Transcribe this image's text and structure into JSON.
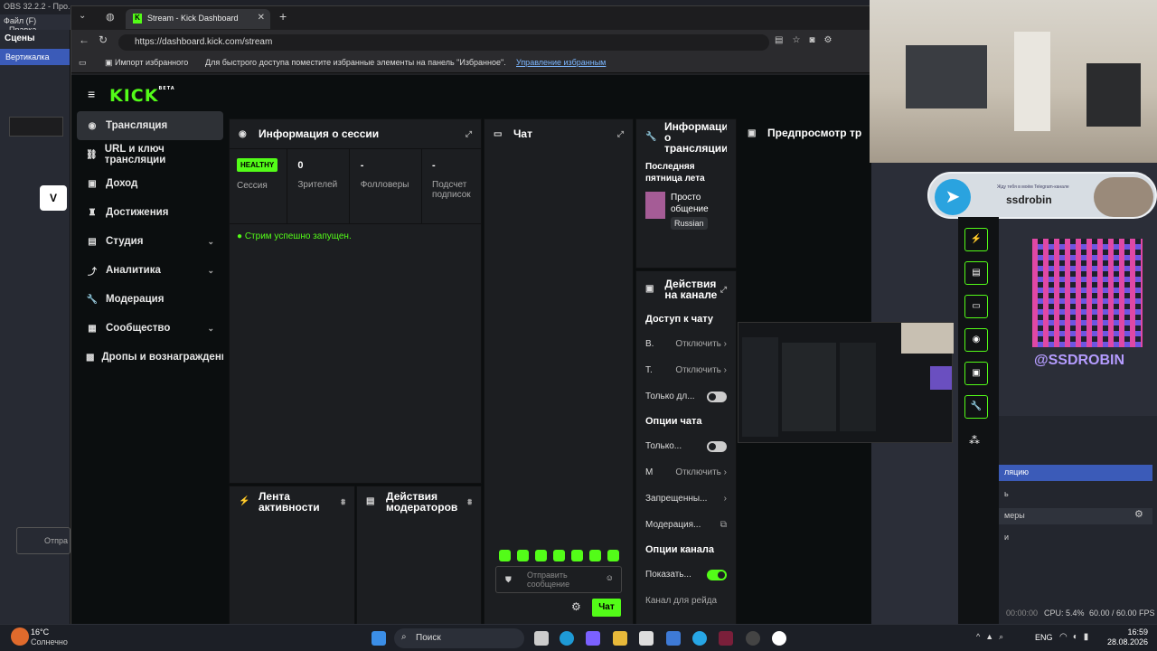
{
  "obs": {
    "title": "OBS 32.2.2 - Про...",
    "menu_file": "Файл (F)",
    "menu_edit": "Правка",
    "scenes_header": "Сцены",
    "scene_selected": "Вертикалка",
    "right_rows": [
      "ляцию",
      "ь",
      "меры",
      "и"
    ],
    "status_time": "00:00:00",
    "cpu": "CPU: 5.4%",
    "fps": "60.00 / 60.00 FPS",
    "chat_placeholder": "Отпра"
  },
  "browser": {
    "tab_title": "Stream - Kick Dashboard",
    "url": "https://dashboard.kick.com/stream",
    "fav_import": "Импорт избранного",
    "fav_hint": "Для быстрого доступа поместите избранные элементы на панель \"Избранное\".",
    "fav_manage": "Управление избранным"
  },
  "kick": {
    "logo": "KICK",
    "beta": "BETA",
    "nav": [
      {
        "label": "Трансляция",
        "icon": "play-circle-icon"
      },
      {
        "label": "URL и ключ трансляции",
        "icon": "link-icon"
      },
      {
        "label": "Доход",
        "icon": "money-icon"
      },
      {
        "label": "Достижения",
        "icon": "trophy-icon"
      },
      {
        "label": "Студия",
        "icon": "studio-icon"
      },
      {
        "label": "Аналитика",
        "icon": "analytics-icon"
      },
      {
        "label": "Модерация",
        "icon": "wrench-icon"
      },
      {
        "label": "Сообщество",
        "icon": "community-icon"
      },
      {
        "label": "Дропы и вознаграждени",
        "icon": "gift-icon"
      }
    ],
    "session": {
      "title": "Информация о сессии",
      "badge": "HEALTHY",
      "session_label": "Сессия",
      "viewers_value": "0",
      "viewers_label": "Зрителей",
      "followers_value": "-",
      "followers_label": "Фолловеры",
      "subs_value": "-",
      "subs_label": "Подсчет подписок",
      "status": "Стрим успешно запущен."
    },
    "chat": {
      "title": "Чат",
      "placeholder": "Отправить сообщение",
      "send": "Чат"
    },
    "stream_info": {
      "title": "Информация о трансляции",
      "stream_title": "Последняя пятница лета",
      "category": "Просто общение",
      "language": "Russian"
    },
    "channel_actions": {
      "title": "Действия на канале",
      "chat_access": "Доступ к чату",
      "row_v": "В.",
      "row_t": "Т.",
      "disable": "Отключить",
      "only_for": "Только дл...",
      "chat_options": "Опции чата",
      "only": "Только...",
      "row_m": "М",
      "banned": "Запрещенны...",
      "moderation": "Модерация...",
      "channel_options": "Опции канала",
      "show": "Показать...",
      "raid": "Канал для рейда"
    },
    "activity": {
      "title": "Лента активности"
    },
    "mod_actions": {
      "title": "Действия модераторов"
    },
    "preview": {
      "title": "Предпросмотр тр"
    }
  },
  "overlay": {
    "tg_small": "Жду тебя в моём Telegram-канале",
    "tg_name": "ssdrobin",
    "qr_text": "@SSDROBIN"
  },
  "taskbar": {
    "weather_temp": "16°C",
    "weather_desc": "Солнечно",
    "search": "Поиск",
    "lang": "ENG",
    "time": "16:59",
    "date": "28.08.2026"
  }
}
